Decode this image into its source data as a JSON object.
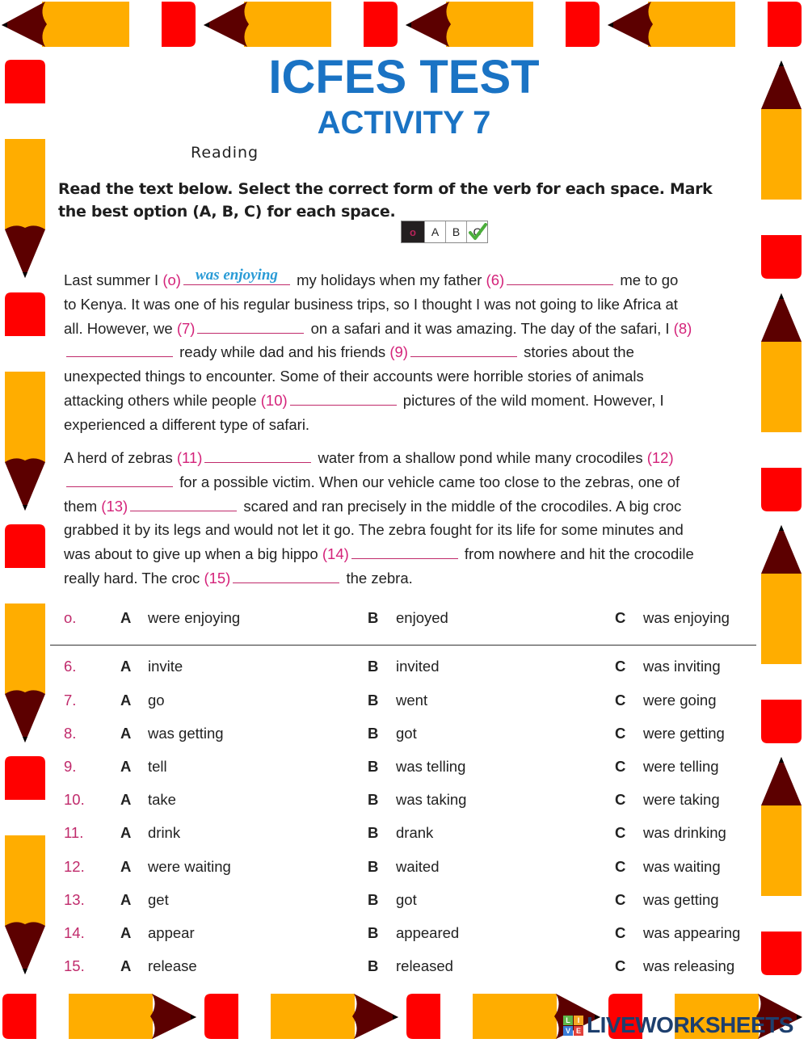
{
  "header": {
    "title": "ICFES TEST",
    "subtitle": "ACTIVITY 7",
    "section": "Reading"
  },
  "instructions": "Read the text below. Select the correct form of the verb for each space. Mark the best option (A, B, C) for each space.",
  "answer_key_example": {
    "cells": [
      "o",
      "A",
      "B",
      "C"
    ],
    "selected": "C"
  },
  "colors": {
    "title": "#1a73c4",
    "number": "#d4237a",
    "filled_answer": "#2a9bd6",
    "pencil_body": "#ffad00",
    "pencil_eraser": "#ff0000",
    "pencil_tip": "#5c0000"
  },
  "passage": {
    "p1": {
      "s1": "Last summer I",
      "n0": "(o)",
      "a0": "was enjoying",
      "s2": "my holidays when my father",
      "n6": "(6)",
      "s3": "me to go to Kenya. It was one of his regular business trips, so I thought I was not going to like Africa at all. However, we",
      "n7": "(7)",
      "s4": "on a  safari and it was amazing. The day of the safari, I",
      "n8": "(8)",
      "s5": "ready while dad and his friends",
      "n9": "(9)",
      "s6": "stories about the unexpected things to encounter. Some of their accounts were horrible stories of animals attacking others while people",
      "n10": "(10)",
      "s7": "pictures of the wild moment. However, I experienced a different type of safari."
    },
    "p2": {
      "s1": "A herd of zebras",
      "n11": "(11)",
      "s2": "water from a shallow pond while many crocodiles",
      "n12": "(12)",
      "s3": "for a possible victim. When our vehicle came too close to the zebras, one of them",
      "n13": "(13)",
      "s4": "scared and ran precisely in the middle of the crocodiles. A big croc grabbed it by its legs and would not let it go. The zebra fought for its life for some minutes and was about to give up when a big hippo",
      "n14": "(14)",
      "s5": "from nowhere and hit the crocodile really hard. The croc",
      "n15": "(15)",
      "s6": "the zebra."
    }
  },
  "options": [
    {
      "q": "o.",
      "a": "were enjoying",
      "b": "enjoyed",
      "c": "was enjoying"
    },
    {
      "q": "6.",
      "a": "invite",
      "b": "invited",
      "c": "was inviting"
    },
    {
      "q": "7.",
      "a": "go",
      "b": "went",
      "c": "were going"
    },
    {
      "q": "8.",
      "a": "was getting",
      "b": "got",
      "c": "were getting"
    },
    {
      "q": "9.",
      "a": "tell",
      "b": "was telling",
      "c": "were telling"
    },
    {
      "q": "10.",
      "a": "take",
      "b": "was taking",
      "c": "were taking"
    },
    {
      "q": "11.",
      "a": "drink",
      "b": "drank",
      "c": "was drinking"
    },
    {
      "q": "12.",
      "a": "were waiting",
      "b": "waited",
      "c": "was waiting"
    },
    {
      "q": "13.",
      "a": "get",
      "b": "got",
      "c": "was getting"
    },
    {
      "q": "14.",
      "a": "appear",
      "b": "appeared",
      "c": "was appearing"
    },
    {
      "q": "15.",
      "a": "release",
      "b": "released",
      "c": "was releasing"
    }
  ],
  "option_letters": {
    "a": "A",
    "b": "B",
    "c": "C"
  },
  "watermark": {
    "logo_letters": [
      "L",
      "I",
      "V",
      "E"
    ],
    "text": "LIVEWORKSHEETS"
  }
}
